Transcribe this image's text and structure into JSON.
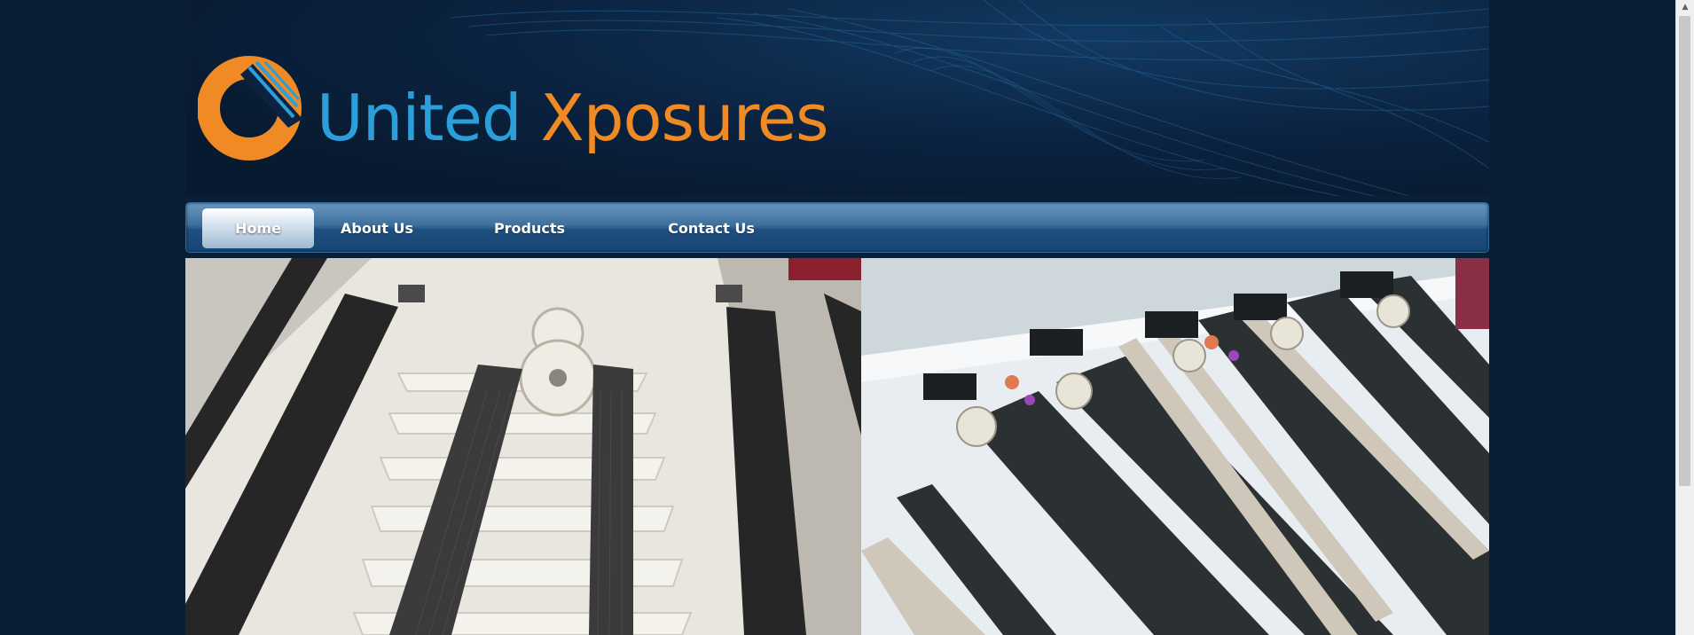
{
  "brand": {
    "word1": "United",
    "word2": "Xposures"
  },
  "nav": {
    "items": [
      {
        "label": "Home",
        "active": true
      },
      {
        "label": "About Us",
        "active": false
      },
      {
        "label": "Products",
        "active": false
      },
      {
        "label": "Contact Us",
        "active": false
      }
    ]
  },
  "colors": {
    "background": "#0a1f36",
    "brand_blue": "#2a9fd9",
    "brand_orange": "#f08a24"
  },
  "hero": {
    "left_image": "processor-rollers-photo",
    "right_image": "roller-assembly-render"
  }
}
